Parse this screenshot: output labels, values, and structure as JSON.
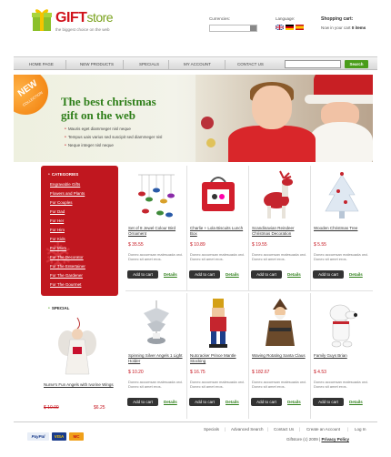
{
  "header": {
    "logo_gift": "GIFT",
    "logo_store": "store",
    "tagline": "the biggest choice on the web",
    "currencies_label": "Currencies:",
    "language_label": "Language:",
    "cart_title": "Shopping cart:",
    "cart_prefix": "Now in your cart",
    "cart_count": "0 items"
  },
  "nav": {
    "items": [
      "Home page",
      "New products",
      "Specials",
      "My account",
      "Contact us"
    ],
    "search_button": "Search"
  },
  "banner": {
    "badge_top": "NEW",
    "badge_bottom": "COLLECTION",
    "heading_line1": "The best christmas",
    "heading_line2": "gift on the web",
    "bullets": [
      "Mauris eget diammeger nisl neque",
      "Tempus uais varius sed suscipit sed diammeger nisl",
      "Neque integer nisl neque"
    ]
  },
  "sidebar": {
    "categories_title": "Categories",
    "categories": [
      "Engravable Gifts",
      "Flowers and Plants",
      "For Couples",
      "For Dad",
      "For Her",
      "For Him",
      "For Kids",
      "For Mom",
      "For The Decorator",
      "For The Entertainer",
      "For The Gardener",
      "For The Gourmet"
    ],
    "special_title": "Special",
    "special_name": "Nurse's Fun Angels with Ivorine Wings",
    "special_old_price": "$ 10.00",
    "special_new_price": "$6.25"
  },
  "products": [
    {
      "name": "Set of 8 Jewel Colour Bird Ornament",
      "price": "$ 35.55",
      "desc": "Donec accumsan malesuada orci. Donec sit amet eros.",
      "add": "Add to cart",
      "details": "Details"
    },
    {
      "name": "Charlie + Lola Biscuits Lunch Box",
      "price": "$ 10.89",
      "desc": "Donec accumsan malesuada orci. Donec sit amet eros.",
      "add": "Add to cart",
      "details": "Details"
    },
    {
      "name": "Scandinavian Reindeer Christmas Decoration",
      "price": "$ 19.55",
      "desc": "Donec accumsan malesuada orci. Donec sit amet eros.",
      "add": "Add to cart",
      "details": "Details"
    },
    {
      "name": "Wooden Christmas Tree",
      "price": "$ 5.55",
      "desc": "Donec accumsan malesuada orci. Donec sit amet eros.",
      "add": "Add to cart",
      "details": "Details"
    },
    {
      "name": "Spinning Silver Angels 1 Light Holder",
      "price": "$ 10.20",
      "desc": "Donec accumsan malesuada orci. Donec sit amet eros.",
      "add": "Add to cart",
      "details": "Details"
    },
    {
      "name": "Nutcracker Prince Mantle Stocking",
      "price": "$ 16.75",
      "desc": "Donec accumsan malesuada orci. Donec sit amet eros.",
      "add": "Add to cart",
      "details": "Details"
    },
    {
      "name": "Waving Rotating Santa Claus",
      "price": "$ 182.67",
      "desc": "Donec accumsan malesuada orci. Donec sit amet eros.",
      "add": "Add to cart",
      "details": "Details"
    },
    {
      "name": "Family Guys Brian",
      "price": "$ 4.53",
      "desc": "Donec accumsan malesuada orci. Donec sit amet eros.",
      "add": "Add to cart",
      "details": "Details"
    }
  ],
  "footer": {
    "links": [
      "Specials",
      "Advanced Search",
      "Contact Us",
      "Create an Account",
      "Log In"
    ],
    "payments": [
      "PayPal",
      "VISA",
      "MC"
    ],
    "copyright": "Giftstore (c) 2009",
    "privacy": "Privacy Policy"
  },
  "colors": {
    "brand_red": "#c0171f",
    "brand_green": "#4a9d1a",
    "price_red": "#c5131c"
  }
}
